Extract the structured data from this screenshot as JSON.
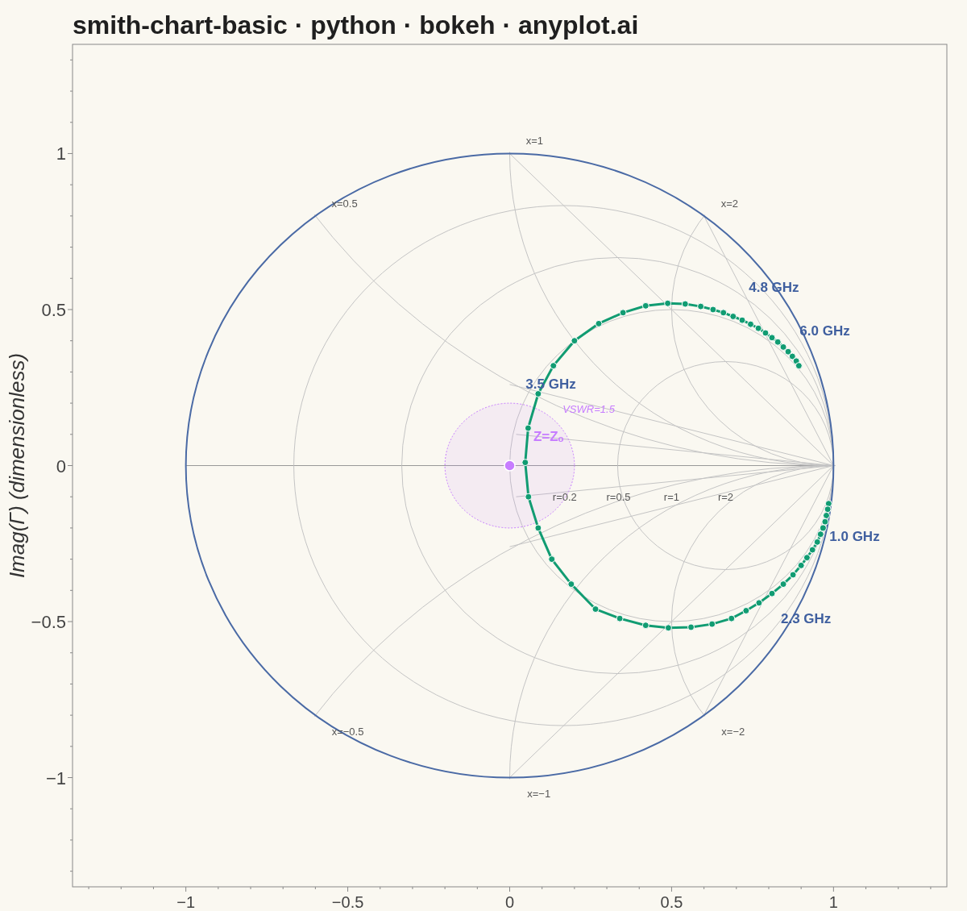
{
  "title": "smith-chart-basic · python · bokeh · anyplot.ai",
  "plot": {
    "chart_data": {
      "type": "line",
      "ylabel": "Imag(Γ)  (dimensionless)",
      "xlim": [
        -1.35,
        1.35
      ],
      "ylim": [
        -1.35,
        1.35
      ],
      "xticks": [
        {
          "value": -1,
          "label": "−1"
        },
        {
          "value": -0.5,
          "label": "−0.5"
        },
        {
          "value": 0,
          "label": "0"
        },
        {
          "value": 0.5,
          "label": "0.5"
        },
        {
          "value": 1,
          "label": "1"
        }
      ],
      "yticks": [
        {
          "value": 1,
          "label": "1"
        },
        {
          "value": 0.5,
          "label": "0.5"
        },
        {
          "value": 0,
          "label": "0"
        },
        {
          "value": -0.5,
          "label": "−0.5"
        },
        {
          "value": -1,
          "label": "−1"
        }
      ],
      "series": [
        {
          "color": "#119c72",
          "marker": "circle",
          "x": [
            0.985,
            0.982,
            0.978,
            0.974,
            0.968,
            0.96,
            0.95,
            0.935,
            0.918,
            0.9,
            0.875,
            0.845,
            0.81,
            0.77,
            0.73,
            0.685,
            0.625,
            0.56,
            0.49,
            0.42,
            0.34,
            0.265,
            0.19,
            0.13,
            0.088,
            0.058,
            0.048,
            0.057,
            0.088,
            0.135,
            0.2,
            0.275,
            0.35,
            0.42,
            0.488,
            0.542,
            0.59,
            0.628,
            0.66,
            0.69,
            0.718,
            0.744,
            0.768,
            0.79,
            0.81,
            0.828,
            0.845,
            0.86,
            0.873,
            0.885,
            0.893
          ],
          "values": [
            -0.122,
            -0.14,
            -0.16,
            -0.18,
            -0.2,
            -0.22,
            -0.245,
            -0.27,
            -0.295,
            -0.32,
            -0.35,
            -0.38,
            -0.41,
            -0.44,
            -0.465,
            -0.49,
            -0.508,
            -0.518,
            -0.52,
            -0.512,
            -0.49,
            -0.46,
            -0.38,
            -0.3,
            -0.2,
            -0.1,
            0.01,
            0.12,
            0.23,
            0.32,
            0.4,
            0.455,
            0.49,
            0.512,
            0.52,
            0.518,
            0.51,
            0.5,
            0.49,
            0.478,
            0.466,
            0.453,
            0.44,
            0.425,
            0.41,
            0.396,
            0.38,
            0.365,
            0.35,
            0.335,
            0.32
          ]
        }
      ]
    },
    "grid_labels": [
      "x=1",
      "x=0.5",
      "x=2",
      "r=0.2",
      "r=0.5",
      "r=1",
      "r=2",
      "x=−0.5",
      "x=−2",
      "x=−1"
    ],
    "frequency_labels": [
      "4.8 GHz",
      "6.0 GHz",
      "3.5 GHz",
      "1.0 GHz",
      "2.3 GHz"
    ],
    "vswr_label": "VSWR=1.5",
    "matched_point_label": "Z=Zₒ"
  }
}
